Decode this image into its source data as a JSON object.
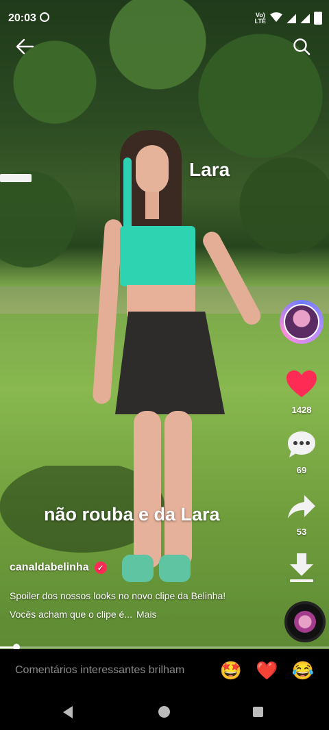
{
  "status_bar": {
    "time": "20:03",
    "network": "LTE"
  },
  "overlay": {
    "name_tag": "Lara",
    "caption": "não rouba e da Lara"
  },
  "actions": {
    "likes": "1428",
    "comments": "69",
    "shares": "53"
  },
  "author": {
    "username": "canaldabelinha",
    "verified": true
  },
  "description": {
    "text": "Spoiler dos nossos looks no novo clipe da Belinha! Vocês acham que o clipe é...",
    "more_label": "Mais"
  },
  "progress": {
    "played_fraction": 0.05
  },
  "comment_bar": {
    "placeholder": "Comentários interessantes brilham",
    "emojis": [
      "🤩",
      "❤️",
      "😂"
    ]
  },
  "colors": {
    "like": "#fe2c55",
    "verified": "#fe2c55"
  },
  "icons": [
    "back-arrow-icon",
    "search-icon",
    "heart-icon",
    "comment-icon",
    "share-icon",
    "download-icon"
  ]
}
